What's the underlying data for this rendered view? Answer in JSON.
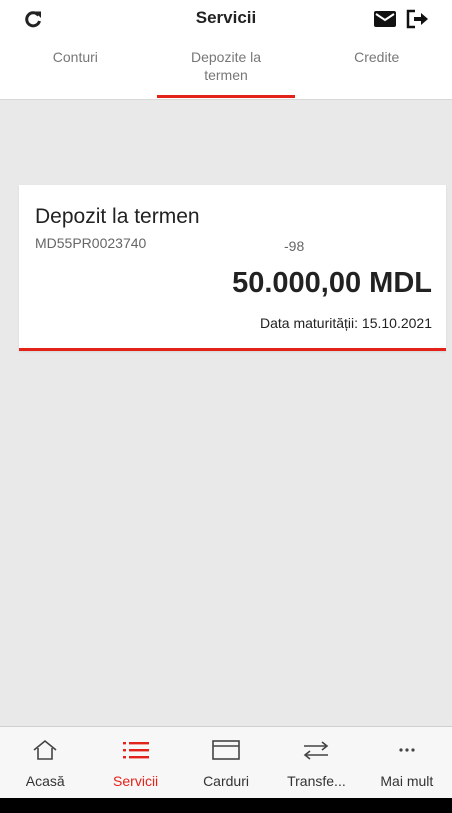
{
  "header": {
    "title": "Servicii",
    "icons": [
      "refresh-icon",
      "mail-icon",
      "logout-icon"
    ]
  },
  "tabs": [
    {
      "label_line1": "Conturi",
      "label_line2": ""
    },
    {
      "label_line1": "Depozite la",
      "label_line2": "termen",
      "active": true
    },
    {
      "label_line1": "Credite",
      "label_line2": ""
    }
  ],
  "deposit": {
    "title": "Depozit la termen",
    "account": "MD55PR0023740",
    "account_suffix": "-98",
    "amount": "50.000,00 MDL",
    "maturity": "Data maturității: 15.10.2021"
  },
  "bottom_nav": [
    {
      "label": "Acasă",
      "icon": "home-icon"
    },
    {
      "label": "Servicii",
      "icon": "list-icon",
      "active": true
    },
    {
      "label": "Carduri",
      "icon": "card-icon"
    },
    {
      "label": "Transfe...",
      "icon": "transfer-icon"
    },
    {
      "label": "Mai mult",
      "icon": "more-icon"
    }
  ],
  "colors": {
    "accent": "#e32219",
    "background": "#e9e9e9"
  }
}
